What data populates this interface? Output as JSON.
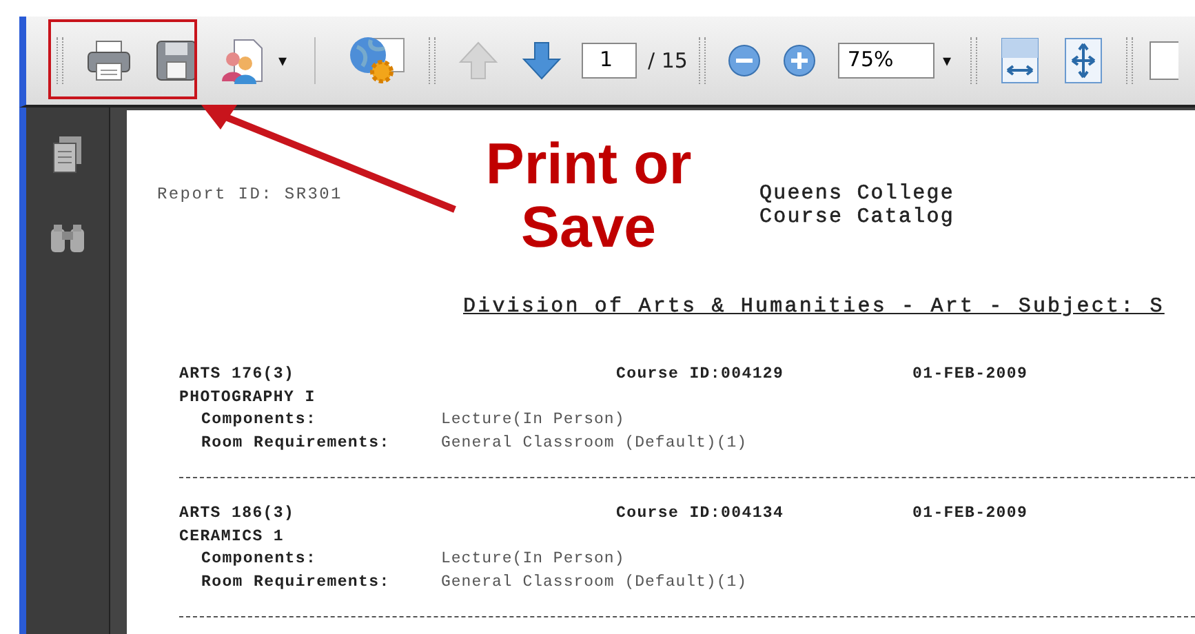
{
  "toolbar": {
    "page_number": "1",
    "page_total": "/ 15",
    "zoom": "75%",
    "zoom_caret": "▾",
    "share_caret": "▾"
  },
  "callout": {
    "lines": [
      "Print or",
      "Save"
    ]
  },
  "report": {
    "report_id": "Report ID:  SR301",
    "institution": [
      "Queens College",
      "Course Catalog"
    ],
    "heading": "Division of Arts & Humanities - Art - Subject: S",
    "courses": [
      {
        "code": "ARTS  176(3)",
        "course_id": "Course ID:004129",
        "date": "01-FEB-2009",
        "title": "PHOTOGRAPHY I",
        "components_label": "Components:",
        "components": "Lecture(In Person)",
        "room_label": "Room Requirements:",
        "room": "General Classroom (Default)(1)"
      },
      {
        "code": "ARTS  186(3)",
        "course_id": "Course ID:004134",
        "date": "01-FEB-2009",
        "title": "CERAMICS 1",
        "components_label": "Components:",
        "components": "Lecture(In Person)",
        "room_label": "Room Requirements:",
        "room": "General Classroom (Default)(1)"
      }
    ]
  }
}
